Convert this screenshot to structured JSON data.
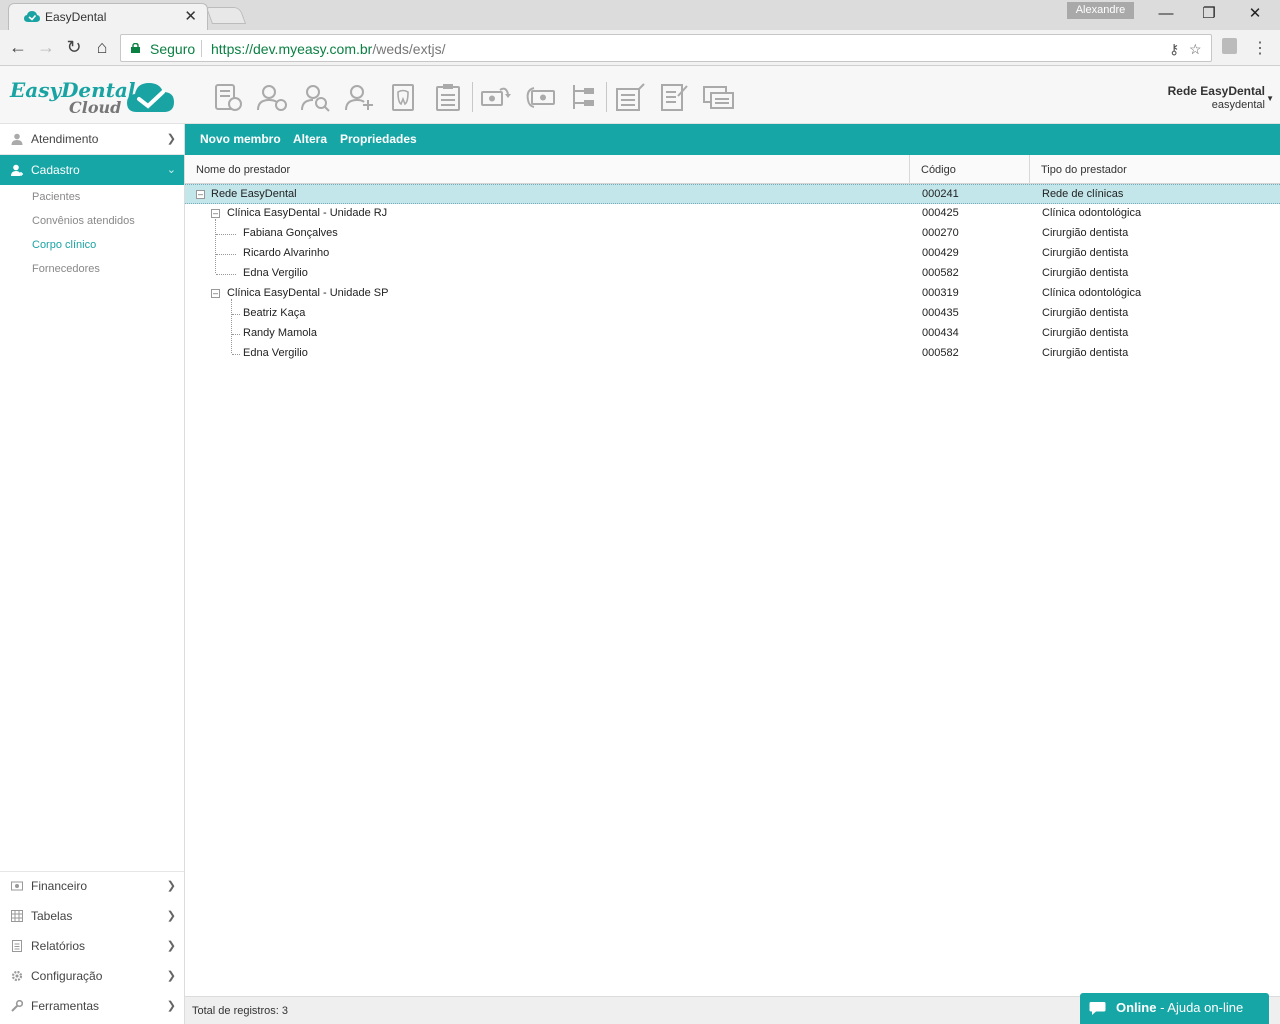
{
  "browser": {
    "tab_title": "EasyDental",
    "profile": "Alexandre",
    "secure_label": "Seguro",
    "url_host": "https://dev.myeasy.com.br",
    "url_path": "/weds/extjs/",
    "icons": [
      "back-icon",
      "forward-icon",
      "reload-icon",
      "home-icon",
      "key-icon",
      "star-icon",
      "pdf-icon",
      "menu-icon"
    ]
  },
  "brand": {
    "name_line1": "EasyDental",
    "name_line2": "Cloud",
    "accent_color": "#17a6a6"
  },
  "toolbar_icons": [
    "agenda-icon",
    "patient-clock-icon",
    "patient-search-icon",
    "patient-add-icon",
    "tooth-chart-icon",
    "clipboard-icon",
    "money-refresh-icon",
    "money-cycle-icon",
    "hierarchy-icon",
    "form-edit-icon",
    "document-edit-icon",
    "message-icon"
  ],
  "account": {
    "name": "Rede EasyDental",
    "user": "easydental"
  },
  "sidebar": {
    "top_items": [
      {
        "label": "Atendimento",
        "icon": "person-icon",
        "active": false
      },
      {
        "label": "Cadastro",
        "icon": "person-add-icon",
        "active": true
      }
    ],
    "sub_items": [
      {
        "label": "Pacientes",
        "active": false
      },
      {
        "label": "Convênios atendidos",
        "active": false
      },
      {
        "label": "Corpo clínico",
        "active": true
      },
      {
        "label": "Fornecedores",
        "active": false
      }
    ],
    "bottom_items": [
      {
        "label": "Financeiro",
        "icon": "cash-icon"
      },
      {
        "label": "Tabelas",
        "icon": "table-icon"
      },
      {
        "label": "Relatórios",
        "icon": "report-icon"
      },
      {
        "label": "Configuração",
        "icon": "gear-icon"
      },
      {
        "label": "Ferramentas",
        "icon": "wrench-icon"
      }
    ]
  },
  "actions": [
    "Novo membro",
    "Altera",
    "Propriedades"
  ],
  "grid": {
    "columns": [
      "Nome do prestador",
      "Código",
      "Tipo do prestador"
    ],
    "rows": [
      {
        "name": "Rede EasyDental",
        "code": "000241",
        "type": "Rede de clínicas"
      },
      {
        "name": "Clínica EasyDental - Unidade RJ",
        "code": "000425",
        "type": "Clínica odontológica"
      },
      {
        "name": "Fabiana Gonçalves",
        "code": "000270",
        "type": "Cirurgião dentista"
      },
      {
        "name": "Ricardo Alvarinho",
        "code": "000429",
        "type": "Cirurgião dentista"
      },
      {
        "name": "Edna Vergilio",
        "code": "000582",
        "type": "Cirurgião dentista"
      },
      {
        "name": "Clínica EasyDental - Unidade SP",
        "code": "000319",
        "type": "Clínica odontológica"
      },
      {
        "name": "Beatriz Kaça",
        "code": "000435",
        "type": "Cirurgião dentista"
      },
      {
        "name": "Randy Mamola",
        "code": "000434",
        "type": "Cirurgião dentista"
      },
      {
        "name": "Edna Vergilio",
        "code": "000582",
        "type": "Cirurgião dentista"
      }
    ]
  },
  "footer": {
    "total_label": "Total de registros: 3"
  },
  "help": {
    "status": "Online",
    "text": " - Ajuda on-line"
  }
}
